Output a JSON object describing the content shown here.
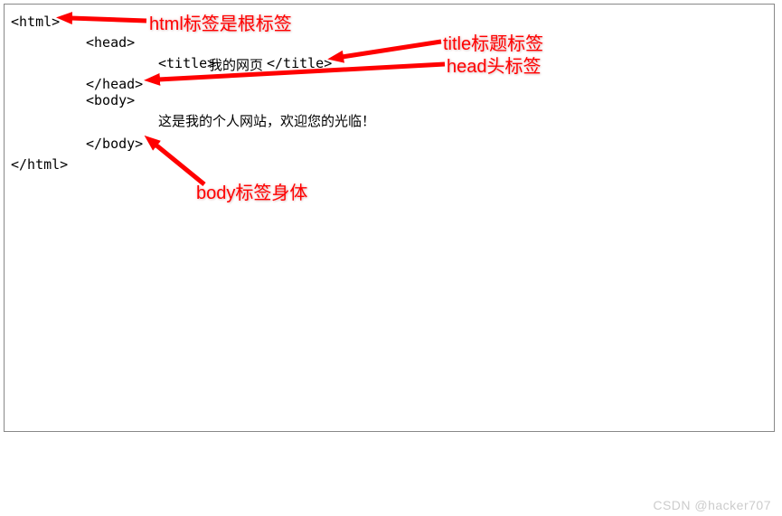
{
  "code": {
    "l1": "<html>",
    "l2": "<head>",
    "l3a": "<title>",
    "l3b": "我的网页",
    "l3c": "</title>",
    "l4": "</head>",
    "l5": "<body>",
    "l6": "这是我的个人网站，欢迎您的光临！",
    "l7": "</body>",
    "l8": "</html>"
  },
  "annotations": {
    "html_root": "html标签是根标签",
    "title_tag": "title标题标签",
    "head_tag": "head头标签",
    "body_tag": "body标签身体"
  },
  "watermark": "CSDN @hacker707"
}
